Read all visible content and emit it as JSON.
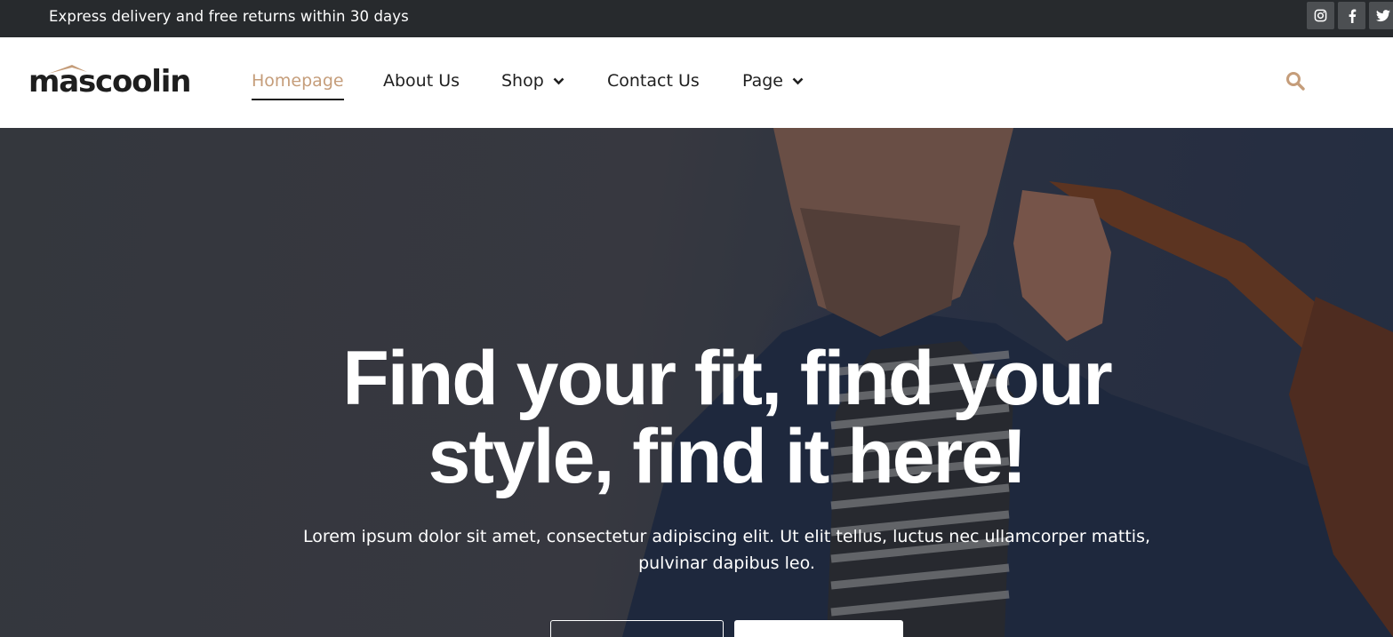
{
  "topbar": {
    "announcement": "Express delivery and free returns within 30 days",
    "social": [
      {
        "icon": "instagram-icon"
      },
      {
        "icon": "facebook-icon"
      },
      {
        "icon": "twitter-icon"
      }
    ]
  },
  "header": {
    "logo_text": "mascoolin",
    "nav": [
      {
        "label": "Homepage",
        "active": true
      },
      {
        "label": "About Us"
      },
      {
        "label": "Shop",
        "dropdown": true
      },
      {
        "label": "Contact Us"
      },
      {
        "label": "Page",
        "dropdown": true
      }
    ],
    "search_icon": "search-icon"
  },
  "hero": {
    "title": "Find your fit, find your style, find it here!",
    "subtitle": "Lorem ipsum dolor sit amet, consectetur adipiscing elit. Ut elit tellus, luctus nec ullamcorper mattis, pulvinar dapibus leo."
  },
  "colors": {
    "accent": "#c59d7a",
    "topbar_bg": "#272a2d",
    "text_dark": "#1f1f1f"
  }
}
